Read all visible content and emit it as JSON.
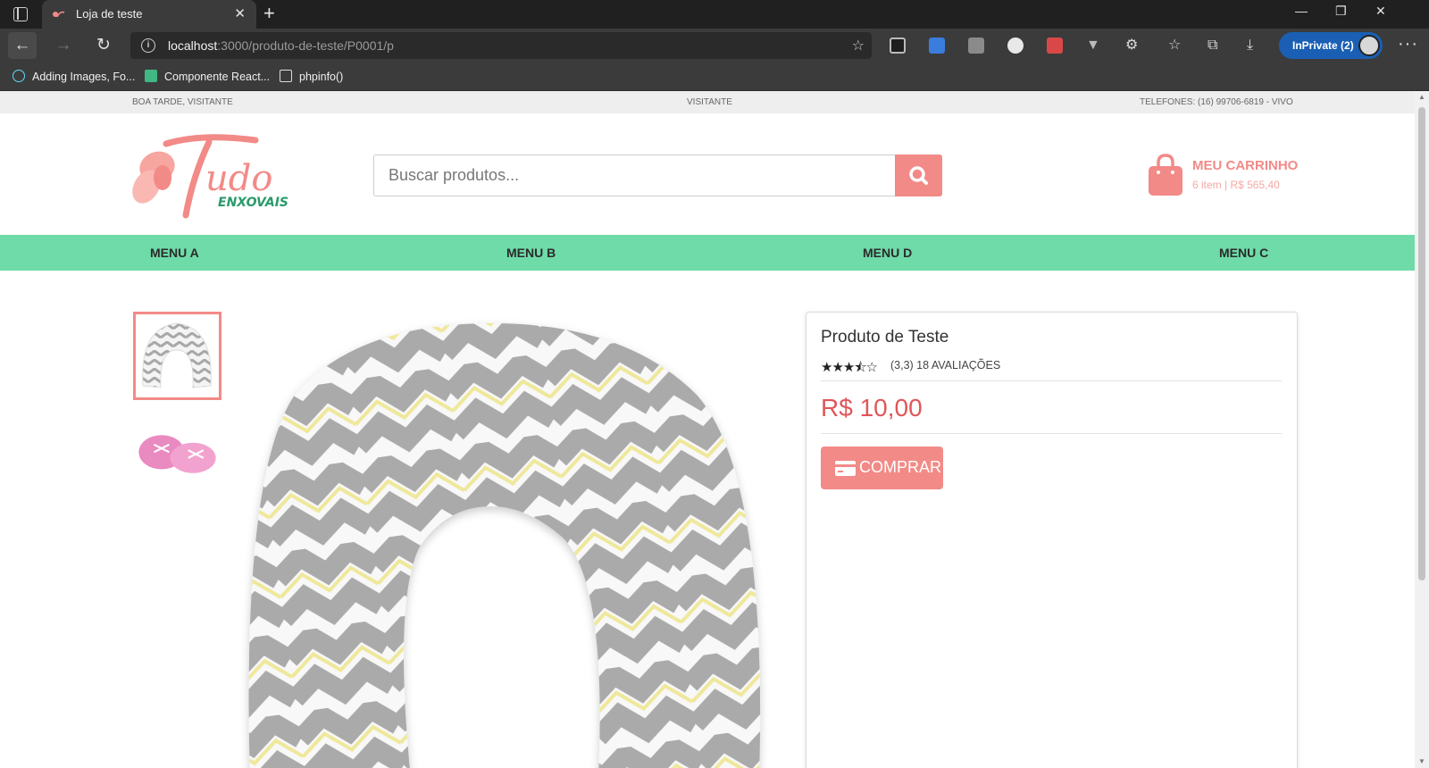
{
  "browser": {
    "tab_title": "Loja de teste",
    "url_host": "localhost",
    "url_path": ":3000/produto-de-teste/P0001/p",
    "inprivate_label": "InPrivate (2)",
    "bookmarks": [
      {
        "label": "Adding Images, Fo...",
        "icon": "react-icon"
      },
      {
        "label": "Componente React...",
        "icon": "vue-icon"
      },
      {
        "label": "phpinfo()",
        "icon": "page-icon"
      }
    ]
  },
  "topbar": {
    "greeting": "BOA TARDE, VISITANTE",
    "center": "VISITANTE",
    "phone": "TELEFONES: (16) 99706-6819 - VIVO"
  },
  "header": {
    "logo_text": "Tudo",
    "logo_subtext": "ENXOVAIS",
    "search_placeholder": "Buscar produtos...",
    "cart_title": "MEU CARRINHO",
    "cart_summary": "6 item | R$ 565,40"
  },
  "menu": [
    "MENU A",
    "MENU B",
    "MENU D",
    "MENU C"
  ],
  "product": {
    "name": "Produto de Teste",
    "stars": "★★★⯪☆",
    "rating_value": 3.3,
    "rating_text": "(3,3) 18 AVALIAÇÕES",
    "price": "R$ 10,00",
    "buy_label": "COMPRAR"
  },
  "colors": {
    "accent": "#f28a87",
    "menu_bg": "#6edba8",
    "price": "#e0565a",
    "logo_green": "#2a9a6a"
  }
}
